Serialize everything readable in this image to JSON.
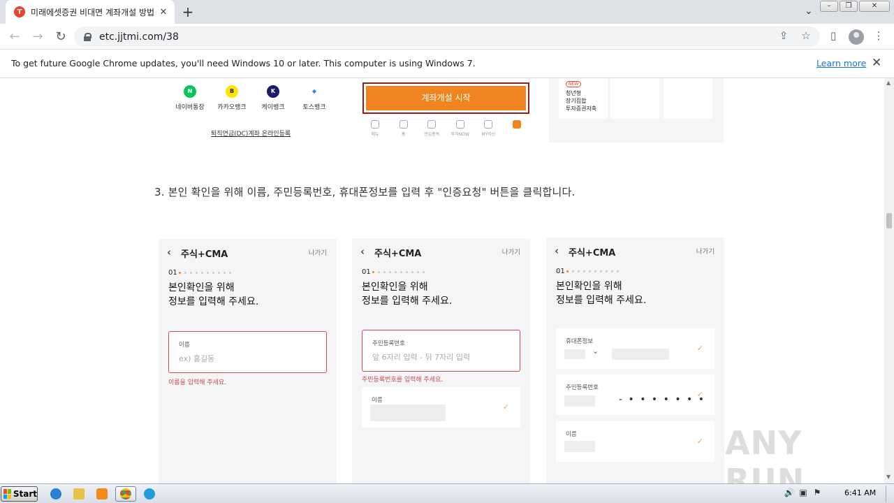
{
  "browser": {
    "tab": {
      "title": "미래에셋증권 비대면 계좌개설 방법",
      "favicon": "T"
    },
    "url": "etc.jjtmi.com/38",
    "window_buttons": [
      "–",
      "❐",
      "✕"
    ]
  },
  "infobar": {
    "message": "To get future Google Chrome updates, you'll need Windows 10 or later. This computer is using Windows 7.",
    "learn_more": "Learn more"
  },
  "top_image": {
    "banks": [
      {
        "name": "네이버통장",
        "logo": "N",
        "color": "#03c75a",
        "text_color": "#fff"
      },
      {
        "name": "카카오뱅크",
        "logo": "B",
        "color": "#fee500",
        "text_color": "#222"
      },
      {
        "name": "케이뱅크",
        "logo": "K",
        "color": "#1d1a6b",
        "text_color": "#fff"
      },
      {
        "name": "토스뱅크",
        "logo": "◆",
        "color": "#ffffff",
        "text_color": "#3182f6"
      }
    ],
    "retire_link": "퇴직연금(DC)계좌 온라인등록",
    "start_button": "계좌개설 시작",
    "app_nav": [
      "메뉴",
      "홈",
      "관심종목",
      "투자NOW",
      "MY자산",
      ""
    ],
    "promo": {
      "badge": "NEW",
      "text": "청년형\n장기집합\n투자증권저축"
    }
  },
  "step3": {
    "text": "3. 본인 확인을 위해 이름, 주민등록번호, 휴대폰정보를 입력 후 \"인증요청\" 버튼을 클릭합니다."
  },
  "phones": [
    {
      "title": "주식+CMA",
      "exit": "나가기",
      "step": "01",
      "heading_line1": "본인확인을 위해",
      "heading_line2": "정보를 입력해 주세요.",
      "field_label": "이름",
      "field_placeholder": "ex) 홍길동",
      "error": "이름을 입력해 주세요."
    },
    {
      "title": "주식+CMA",
      "exit": "나가기",
      "step": "01",
      "heading_line1": "본인확인을 위해",
      "heading_line2": "정보를 입력해 주세요.",
      "field_label": "주민등록번호",
      "field_placeholder": "앞 6자리 입력   -   뒤 7자리 입력",
      "error": "주민등록번호를 입력해 주세요.",
      "second_label": "이름"
    },
    {
      "title": "주식+CMA",
      "exit": "나가기",
      "step": "01",
      "heading_line1": "본인확인을 위해",
      "heading_line2": "정보를 입력해 주세요.",
      "phone_label": "휴대폰정보",
      "rrn_label": "주민등록번호",
      "rrn_mask": "- • • • • • • •",
      "name_label": "이름"
    }
  ],
  "watermark": "ANY RUN",
  "taskbar": {
    "start": "Start",
    "clock": "6:41 AM"
  }
}
